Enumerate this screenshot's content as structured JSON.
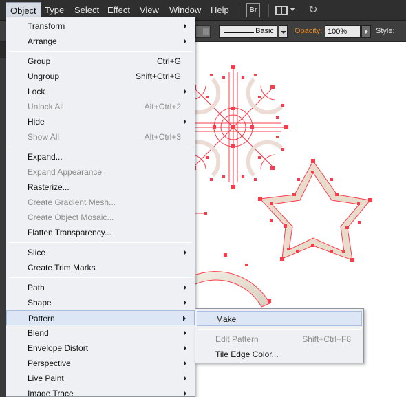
{
  "menubar": {
    "items": [
      "Object",
      "Type",
      "Select",
      "Effect",
      "View",
      "Window",
      "Help"
    ],
    "bridge_label": "Br"
  },
  "controlbar": {
    "brush_label": "Basic",
    "opacity_label": "Opacity:",
    "opacity_value": "100%",
    "style_label": "Style:"
  },
  "object_menu": {
    "items": [
      {
        "label": "Transform",
        "shortcut": "",
        "submenu": true,
        "enabled": true
      },
      {
        "label": "Arrange",
        "shortcut": "",
        "submenu": true,
        "enabled": true
      },
      {
        "label": "Group",
        "shortcut": "Ctrl+G",
        "submenu": false,
        "enabled": true
      },
      {
        "label": "Ungroup",
        "shortcut": "Shift+Ctrl+G",
        "submenu": false,
        "enabled": true
      },
      {
        "label": "Lock",
        "shortcut": "",
        "submenu": true,
        "enabled": true
      },
      {
        "label": "Unlock All",
        "shortcut": "Alt+Ctrl+2",
        "submenu": false,
        "enabled": false
      },
      {
        "label": "Hide",
        "shortcut": "",
        "submenu": true,
        "enabled": true
      },
      {
        "label": "Show All",
        "shortcut": "Alt+Ctrl+3",
        "submenu": false,
        "enabled": false
      },
      {
        "label": "Expand...",
        "shortcut": "",
        "submenu": false,
        "enabled": true
      },
      {
        "label": "Expand Appearance",
        "shortcut": "",
        "submenu": false,
        "enabled": false
      },
      {
        "label": "Rasterize...",
        "shortcut": "",
        "submenu": false,
        "enabled": true
      },
      {
        "label": "Create Gradient Mesh...",
        "shortcut": "",
        "submenu": false,
        "enabled": false
      },
      {
        "label": "Create Object Mosaic...",
        "shortcut": "",
        "submenu": false,
        "enabled": false
      },
      {
        "label": "Flatten Transparency...",
        "shortcut": "",
        "submenu": false,
        "enabled": true
      },
      {
        "label": "Slice",
        "shortcut": "",
        "submenu": true,
        "enabled": true
      },
      {
        "label": "Create Trim Marks",
        "shortcut": "",
        "submenu": false,
        "enabled": true
      },
      {
        "label": "Path",
        "shortcut": "",
        "submenu": true,
        "enabled": true
      },
      {
        "label": "Shape",
        "shortcut": "",
        "submenu": true,
        "enabled": true
      },
      {
        "label": "Pattern",
        "shortcut": "",
        "submenu": true,
        "enabled": true
      },
      {
        "label": "Blend",
        "shortcut": "",
        "submenu": true,
        "enabled": true
      },
      {
        "label": "Envelope Distort",
        "shortcut": "",
        "submenu": true,
        "enabled": true
      },
      {
        "label": "Perspective",
        "shortcut": "",
        "submenu": true,
        "enabled": true
      },
      {
        "label": "Live Paint",
        "shortcut": "",
        "submenu": true,
        "enabled": true
      },
      {
        "label": "Image Trace",
        "shortcut": "",
        "submenu": true,
        "enabled": true
      }
    ]
  },
  "pattern_submenu": {
    "items": [
      {
        "label": "Make",
        "shortcut": "",
        "enabled": true
      },
      {
        "label": "Edit Pattern",
        "shortcut": "Shift+Ctrl+F8",
        "enabled": false
      },
      {
        "label": "Tile Edge Color...",
        "shortcut": "",
        "enabled": true
      }
    ]
  },
  "colors": {
    "selection": "#ff3b4a",
    "menubar_bg": "#2f2f2f",
    "menu_bg": "#eef0f3",
    "hover_bg": "#dce6f4",
    "opacity_label": "#e08a26"
  }
}
